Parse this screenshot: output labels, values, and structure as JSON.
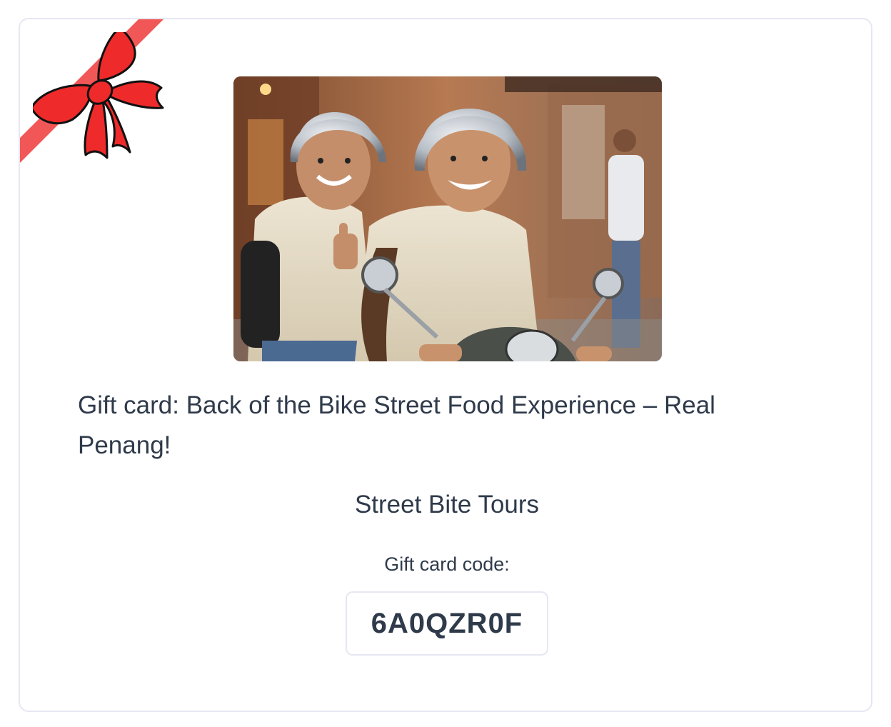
{
  "gift_card": {
    "title": "Gift card: Back of the Bike Street Food Experience – Real Penang!",
    "vendor": "Street Bite Tours",
    "code_label": "Gift card code:",
    "code": "6A0QZR0F",
    "image_alt": "Two smiling riders in silver helmets on a scooter on a busy street"
  },
  "icons": {
    "ribbon": "gift-bow-icon"
  },
  "colors": {
    "ribbon_red": "#ee2a2a",
    "ribbon_light": "#f25757",
    "text": "#2f3a4a",
    "border": "#e6e7f3"
  }
}
